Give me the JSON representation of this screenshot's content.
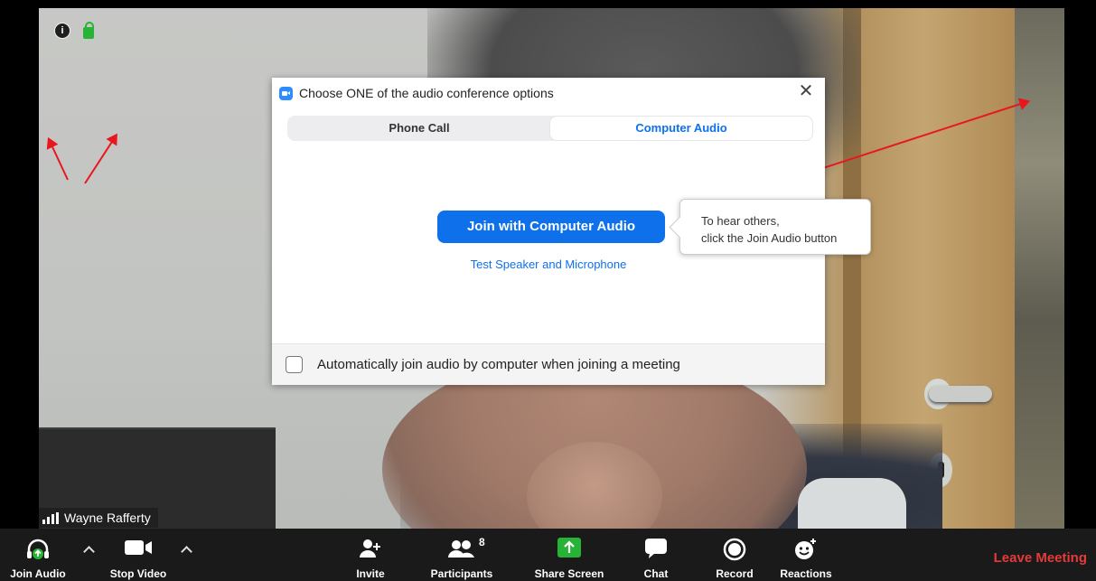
{
  "video": {
    "participant_name": "Wayne Rafferty"
  },
  "dialog": {
    "title": "Choose ONE of the audio conference options",
    "tabs": [
      {
        "label": "Phone Call",
        "active": false
      },
      {
        "label": "Computer Audio",
        "active": true
      }
    ],
    "join_button": "Join with Computer Audio",
    "test_link": "Test Speaker and Microphone",
    "tooltip_line1": "To hear others,",
    "tooltip_line2": "click the Join Audio button",
    "auto_join_label": "Automatically join audio by computer when joining a meeting",
    "auto_join_checked": false
  },
  "toolbar": {
    "join_audio": "Join Audio",
    "stop_video": "Stop Video",
    "invite": "Invite",
    "participants": "Participants",
    "participant_count": "8",
    "share_screen": "Share Screen",
    "chat": "Chat",
    "record": "Record",
    "reactions": "Reactions",
    "leave_meeting": "Leave Meeting"
  },
  "colors": {
    "accent": "#0e71eb",
    "share_green": "#27b336",
    "leave_red": "#e53a3a",
    "annotation_arrow": "#e8171d"
  }
}
